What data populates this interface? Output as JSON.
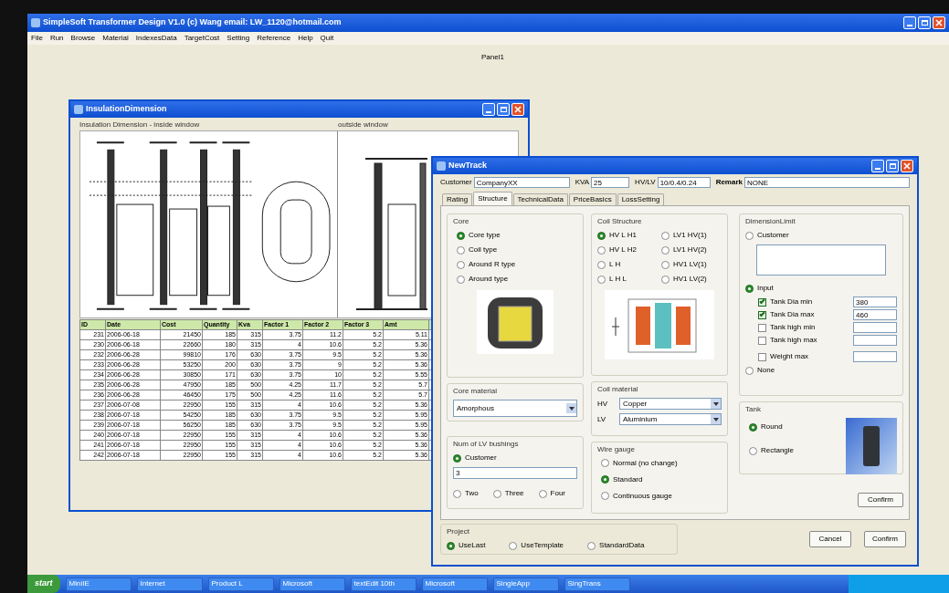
{
  "app": {
    "title": "SimpleSoft Transformer Design V1.0   (c) Wang email: LW_1120@hotmail.com",
    "menu": [
      "File",
      "Run",
      "Browse",
      "Material",
      "IndexesData",
      "TargetCost",
      "Setting",
      "Reference",
      "Help",
      "Quit"
    ],
    "panel_label": "Panel1"
  },
  "insulation_window": {
    "title": "InsulationDimension",
    "inside_label": "Insulation Dimension - inside window",
    "outside_label": "outside window",
    "table": {
      "columns": [
        "ID",
        "Date",
        "Cost",
        "Quantity",
        "Kva",
        "Factor 1",
        "Factor 2",
        "Factor 3",
        "Amt"
      ],
      "rows": [
        [
          "231",
          "2006-06-18",
          "21450",
          "185",
          "315",
          "3.75",
          "11.2",
          "5.2",
          "5.11"
        ],
        [
          "230",
          "2006-06-18",
          "22660",
          "180",
          "315",
          "4",
          "10.6",
          "5.2",
          "5.36"
        ],
        [
          "232",
          "2006-06-28",
          "99810",
          "176",
          "630",
          "3.75",
          "9.5",
          "5.2",
          "5.36"
        ],
        [
          "233",
          "2006-06-28",
          "53250",
          "200",
          "630",
          "3.75",
          "9",
          "5.2",
          "5.36"
        ],
        [
          "234",
          "2006-06-28",
          "30850",
          "171",
          "630",
          "3.75",
          "10",
          "5.2",
          "5.55"
        ],
        [
          "235",
          "2006-06-28",
          "47950",
          "185",
          "500",
          "4.25",
          "11.7",
          "5.2",
          "5.7"
        ],
        [
          "236",
          "2006-06-28",
          "46450",
          "175",
          "500",
          "4.25",
          "11.6",
          "5.2",
          "5.7"
        ],
        [
          "237",
          "2006-07-08",
          "22950",
          "155",
          "315",
          "4",
          "10.6",
          "5.2",
          "5.36"
        ],
        [
          "238",
          "2006-07-18",
          "54250",
          "185",
          "630",
          "3.75",
          "9.5",
          "5.2",
          "5.95"
        ],
        [
          "239",
          "2006-07-18",
          "56250",
          "185",
          "630",
          "3.75",
          "9.5",
          "5.2",
          "5.95"
        ],
        [
          "240",
          "2006-07-18",
          "22950",
          "155",
          "315",
          "4",
          "10.6",
          "5.2",
          "5.36"
        ],
        [
          "241",
          "2006-07-18",
          "22950",
          "155",
          "315",
          "4",
          "10.6",
          "5.2",
          "5.36"
        ],
        [
          "242",
          "2006-07-18",
          "22950",
          "155",
          "315",
          "4",
          "10.6",
          "5.2",
          "5.36"
        ]
      ]
    }
  },
  "new_track": {
    "title": "NewTrack",
    "fields": [
      {
        "label": "Customer",
        "value": "CompanyXX",
        "bold": false
      },
      {
        "label": "KVA",
        "value": "25",
        "bold": false
      },
      {
        "label": "HV/LV",
        "value": "10/0.4/0.24",
        "bold": false
      },
      {
        "label": "Remark",
        "value": "NONE",
        "bold": true
      }
    ],
    "tabs": [
      {
        "label": "Rating",
        "selected": false
      },
      {
        "label": "Structure",
        "selected": true
      },
      {
        "label": "TechnicalData",
        "selected": false
      },
      {
        "label": "PriceBasics",
        "selected": false
      },
      {
        "label": "LossSetting",
        "selected": false
      }
    ],
    "core": {
      "title": "Core",
      "options": [
        {
          "label": "Core type",
          "selected": true
        },
        {
          "label": "Coil type",
          "selected": false
        },
        {
          "label": "Around R type",
          "selected": false
        },
        {
          "label": "Around type",
          "selected": false
        }
      ]
    },
    "coil_structure": {
      "title": "Coil Structure",
      "options": [
        {
          "label": "HV L H1",
          "selected": true
        },
        {
          "label": "LV1 HV(1)",
          "selected": false
        },
        {
          "label": "HV L H2",
          "selected": false
        },
        {
          "label": "LV1 HV(2)",
          "selected": false
        },
        {
          "label": "L H",
          "selected": false
        },
        {
          "label": "HV1 LV(1)",
          "selected": false
        },
        {
          "label": "L H L",
          "selected": false
        },
        {
          "label": "HV1 LV(2)",
          "selected": false
        }
      ]
    },
    "dimension_limit": {
      "title": "DimensionLimit",
      "customer": {
        "label": "Customer",
        "selected": false
      },
      "input": {
        "label": "Input",
        "selected": true
      },
      "limits": [
        {
          "label": "Tank Dia min",
          "checked": true,
          "value": "380"
        },
        {
          "label": "Tank Dia max",
          "checked": true,
          "value": "460"
        },
        {
          "label": "Tank high min",
          "checked": false
        },
        {
          "label": "Tank high max",
          "checked": false
        },
        {
          "label": "Weight max",
          "checked": false
        }
      ],
      "none": {
        "label": "None",
        "selected": false
      }
    },
    "core_material": {
      "title": "Core material",
      "value": "Amorphous"
    },
    "coil_material": {
      "title": "Coil material",
      "rows": [
        {
          "label": "HV",
          "value": "Copper"
        },
        {
          "label": "LV",
          "value": "Aluminium"
        }
      ]
    },
    "tank": {
      "title": "Tank",
      "options": [
        {
          "label": "Round",
          "selected": true
        },
        {
          "label": "Rectangle",
          "selected": false
        }
      ]
    },
    "lv_bushings": {
      "title": "Num of LV bushings",
      "customer": {
        "label": "Customer",
        "selected": true
      },
      "value": "3",
      "options": [
        {
          "label": "Two",
          "selected": false
        },
        {
          "label": "Three",
          "selected": false
        },
        {
          "label": "Four",
          "selected": false
        }
      ]
    },
    "wire_gauge": {
      "title": "Wire gauge",
      "options": [
        {
          "label": "Normal (no change)",
          "selected": false
        },
        {
          "label": "Standard",
          "selected": true
        },
        {
          "label": "Continuous gauge",
          "selected": false
        }
      ]
    },
    "confirm_button": "Confirm",
    "project": {
      "title": "Project",
      "options": [
        {
          "label": "UseLast",
          "selected": true
        },
        {
          "label": "UseTemplate",
          "selected": false
        },
        {
          "label": "StandardData",
          "selected": false
        }
      ]
    },
    "buttons": [
      "Cancel",
      "Confirm"
    ]
  },
  "taskbar": {
    "start": "start",
    "items": [
      "MiniIE",
      "Internet",
      "Product L",
      "Microsoft",
      "textEdit 10th",
      "Microsoft",
      "SingleApp",
      "SingTrans"
    ]
  }
}
